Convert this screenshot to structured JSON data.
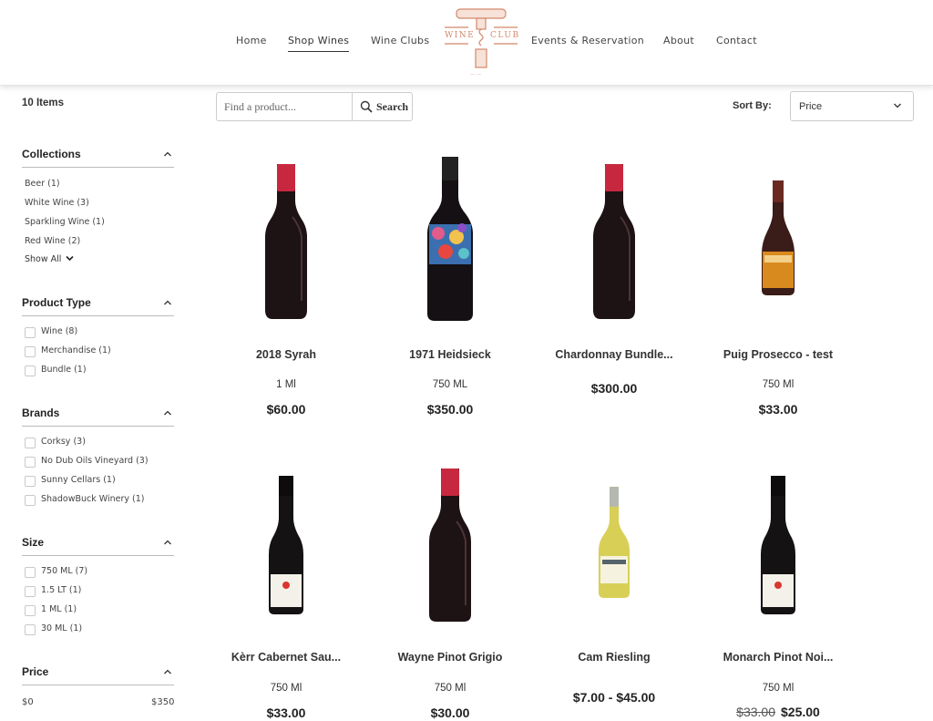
{
  "nav": {
    "home": "Home",
    "shop_wines": "Shop Wines",
    "wine_clubs": "Wine Clubs",
    "events": "Events & Reservation",
    "about": "About",
    "contact": "Contact"
  },
  "logo": {
    "text_left": "WINE",
    "text_right": "CLUB",
    "icon": "corkscrew-icon",
    "color": "#d4886b"
  },
  "sidebar": {
    "items_count": "10 Items",
    "collections": {
      "title": "Collections",
      "options": [
        "Beer (1)",
        "White Wine (3)",
        "Sparkling Wine (1)",
        "Red Wine (2)"
      ],
      "show_all": "Show All"
    },
    "product_type": {
      "title": "Product Type",
      "options": [
        "Wine (8)",
        "Merchandise (1)",
        "Bundle (1)"
      ]
    },
    "brands": {
      "title": "Brands",
      "options": [
        "Corksy (3)",
        "No Dub Oils Vineyard (3)",
        "Sunny Cellars (1)",
        "ShadowBuck Winery (1)"
      ]
    },
    "size": {
      "title": "Size",
      "options": [
        "750 ML (7)",
        "1.5 LT (1)",
        "1 ML (1)",
        "30 ML (1)"
      ]
    },
    "price": {
      "title": "Price",
      "min": "$0",
      "max": "$350"
    }
  },
  "search": {
    "placeholder": "Find a product...",
    "button_label": "Search"
  },
  "sort": {
    "label": "Sort By:",
    "value": "Price"
  },
  "products": [
    {
      "name": "2018 Syrah",
      "size": "1 Ml",
      "price": "$60.00",
      "bottle": "red-capsule"
    },
    {
      "name": "1971 Heidsieck",
      "size": "750 ML",
      "price": "$350.00",
      "bottle": "floral-label"
    },
    {
      "name": "Chardonnay Bundle...",
      "size": "",
      "price": "$300.00",
      "bottle": "red-capsule"
    },
    {
      "name": "Puig Prosecco - test",
      "size": "750 Ml",
      "price": "$33.00",
      "bottle": "prosecco"
    },
    {
      "name": "Kèrr Cabernet Sau...",
      "size": "750 Ml",
      "price": "$33.00",
      "bottle": "dark-white-label"
    },
    {
      "name": "Wayne Pinot Grigio",
      "size": "750 Ml",
      "price": "$30.00",
      "bottle": "red-capsule"
    },
    {
      "name": "Cam Riesling",
      "size": "",
      "price": "$7.00 - $45.00",
      "bottle": "white-wine"
    },
    {
      "name": "Monarch Pinot Noi...",
      "size": "750 Ml",
      "price": "$25.00",
      "old_price": "$33.00",
      "bottle": "dark-white-label"
    }
  ]
}
